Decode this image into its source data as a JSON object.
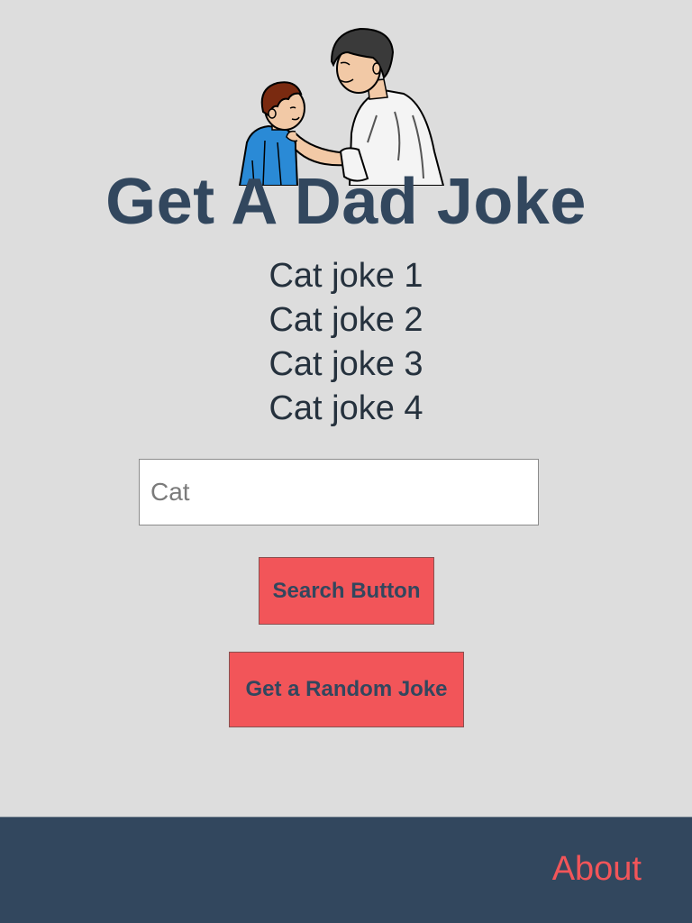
{
  "page": {
    "title": "Get A Dad Joke"
  },
  "hero_image": {
    "icon": "father-and-son-illustration"
  },
  "jokes": [
    "Cat joke 1",
    "Cat joke 2",
    "Cat joke 3",
    "Cat joke 4"
  ],
  "search": {
    "value": "",
    "placeholder": "Cat"
  },
  "buttons": {
    "search_label": "Search Button",
    "random_label": "Get a Random Joke"
  },
  "footer": {
    "about_label": "About"
  },
  "colors": {
    "background": "#dddddd",
    "title": "#32475e",
    "button": "#f25559",
    "footer": "#32475e",
    "link": "#f25559"
  }
}
